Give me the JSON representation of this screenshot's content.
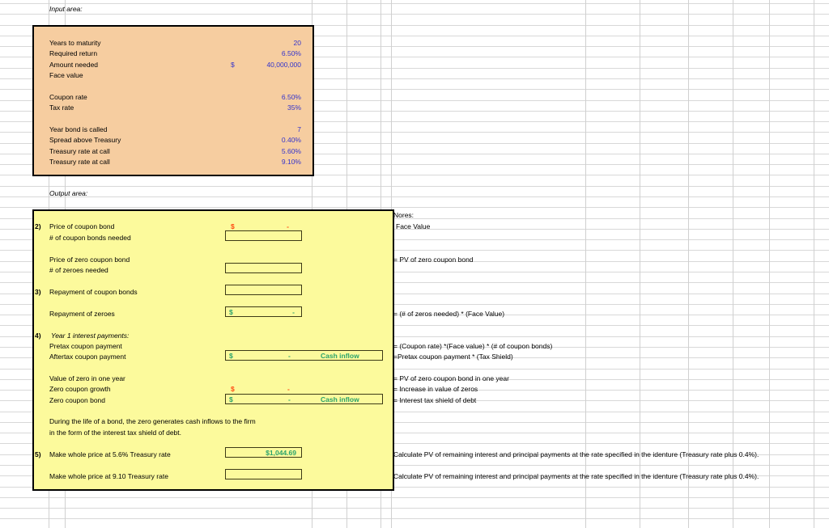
{
  "sheet": {
    "title": "Bond refunding / make-whole worksheet",
    "colors": {
      "input_fill": "#f6cda0",
      "output_fill": "#fcfa9c",
      "input_value": "#3333cc",
      "output_value_green": "#2aa36b",
      "output_value_red": "#ff4b12",
      "gridline": "#d8d8d8"
    }
  },
  "input_area": {
    "heading": "Input area:",
    "rows": [
      {
        "label": "Years to maturity",
        "symbol": "",
        "value": "20"
      },
      {
        "label": "Required return",
        "symbol": "",
        "value": "6.50%"
      },
      {
        "label": "Amount needed",
        "symbol": "$",
        "value": "40,000,000"
      },
      {
        "label": "Face value",
        "symbol": "",
        "value": ""
      },
      {
        "label": "",
        "symbol": "",
        "value": ""
      },
      {
        "label": "Coupon rate",
        "symbol": "",
        "value": "6.50%"
      },
      {
        "label": "Tax rate",
        "symbol": "",
        "value": "35%"
      },
      {
        "label": "",
        "symbol": "",
        "value": ""
      },
      {
        "label": "Year bond is called",
        "symbol": "",
        "value": "7"
      },
      {
        "label": "Spread above Treasury",
        "symbol": "",
        "value": "0.40%"
      },
      {
        "label": "Treasury rate at call",
        "symbol": "",
        "value": "5.60%"
      },
      {
        "label": "Treasury rate at call",
        "symbol": "",
        "value": "9.10%"
      }
    ]
  },
  "output_area": {
    "heading": "Output area:",
    "items": {
      "q2_marker": "2)",
      "price_of_coupon_bond": "Price of coupon bond",
      "price_of_coupon_bond_dollar": "$",
      "price_of_coupon_bond_dash": "-",
      "num_coupon_bonds_needed": "# of coupon bonds needed",
      "num_coupon_bonds_needed_value": "",
      "price_of_zero_coupon_bond": "Price of zero coupon bond",
      "num_zeroes_needed": "# of zeroes needed",
      "num_zeroes_needed_value": "",
      "q3_marker": "3)",
      "repayment_of_coupon_bonds": "Repayment of coupon bonds",
      "repayment_of_coupon_bonds_value": "",
      "repayment_of_zeroes": "Repayment of zeroes",
      "repayment_of_zeroes_dollar": "$",
      "repayment_of_zeroes_dash": "-",
      "q4_marker": "4)",
      "year1_interest_payments": "Year 1 interest payments:",
      "pretax_coupon_payment": "Pretax coupon payment",
      "aftertax_coupon_payment": "Aftertax coupon payment",
      "aftertax_coupon_payment_dollar": "$",
      "aftertax_coupon_payment_dash": "-",
      "aftertax_coupon_payment_tag": "Cash inflow",
      "value_of_zero_in_one_year": "Value of zero in one year",
      "zero_coupon_growth": "Zero coupon growth",
      "zero_coupon_growth_dollar": "$",
      "zero_coupon_growth_dash": "-",
      "zero_coupon_bond": "Zero coupon bond",
      "zero_coupon_bond_dollar": "$",
      "zero_coupon_bond_dash": "-",
      "zero_coupon_bond_tag": "Cash inflow",
      "explanation_line1": "During the life of a bond, the zero generates cash inflows to the firm",
      "explanation_line2": "in the form of the interest tax shield of debt.",
      "q5_marker": "5)",
      "make_whole_56": "Make whole price at 5.6% Treasury rate",
      "make_whole_56_value": "$1,044.69",
      "make_whole_910": "Make whole price at 9.10 Treasury rate",
      "make_whole_910_value": ""
    }
  },
  "notes": {
    "heading": "Nores:",
    "lines": [
      "Face Value",
      "= PV of zero coupon bond",
      "= (# of zeros needed) * (Face Value)",
      "= (Coupon rate) *(Face value) * (# of coupon bonds)",
      "=Pretax coupon payment * (Tax Shield)",
      "= PV of zero coupon bond in one year",
      "= Increase in value of zeros",
      "= Interest tax shield of debt",
      "Calculate PV of remaining interest and principal payments at the rate specified in the identure (Treasury rate plus 0.4%).",
      "Calculate PV of remaining interest and principal payments at the rate specified in the identure (Treasury rate plus 0.4%)."
    ]
  }
}
